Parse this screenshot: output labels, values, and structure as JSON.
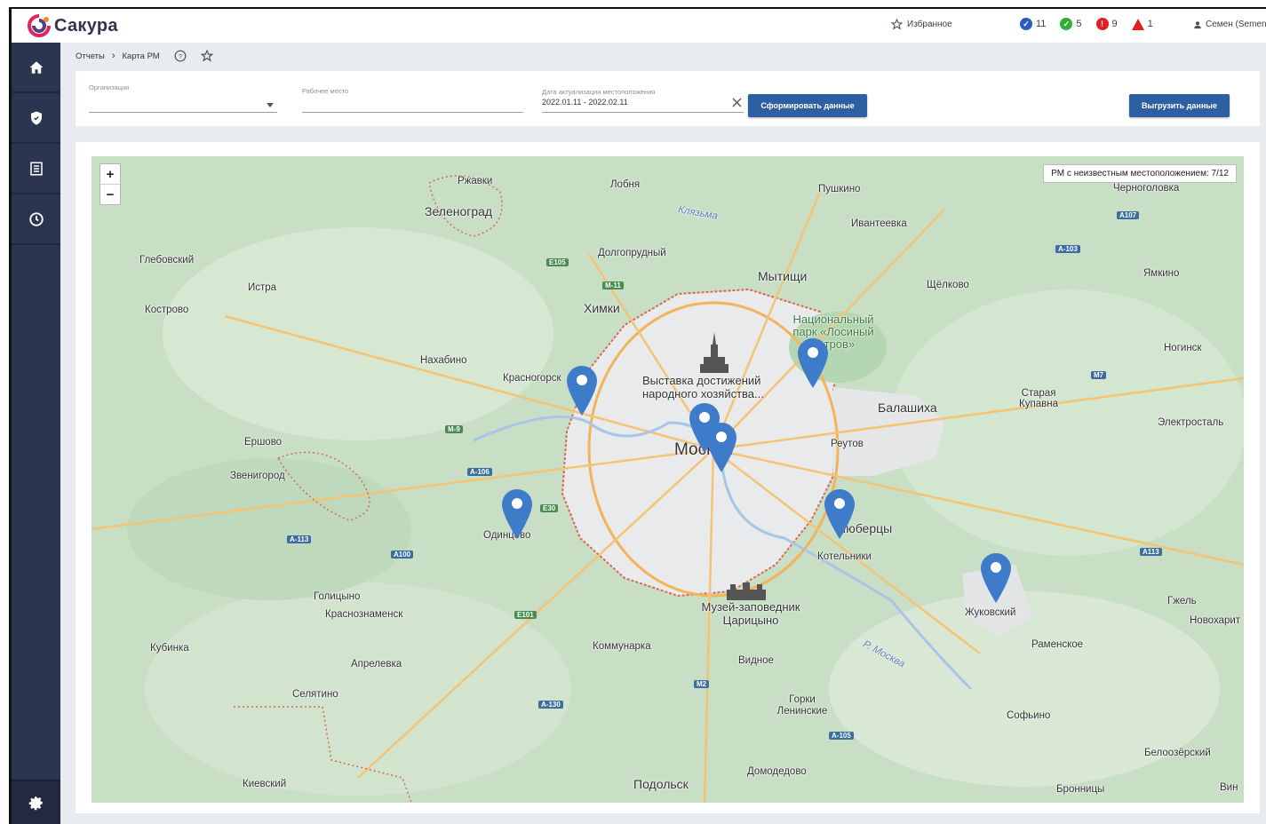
{
  "app": {
    "name": "Сакура"
  },
  "header": {
    "favorites_label": "Избранное",
    "counters": [
      {
        "icon": "check-shield-icon",
        "color": "#2b5eb8",
        "value": "11"
      },
      {
        "icon": "check-circle-icon",
        "color": "#2fae3a",
        "value": "5"
      },
      {
        "icon": "alert-circle-icon",
        "color": "#e02020",
        "value": "9"
      },
      {
        "icon": "warning-triangle-icon",
        "color": "#e02020",
        "value": "1"
      }
    ],
    "user_name": "Семен (Semen)"
  },
  "sidebar": {
    "items": [
      {
        "icon": "home-icon"
      },
      {
        "icon": "shield-icon"
      },
      {
        "icon": "report-icon"
      },
      {
        "icon": "clock-icon"
      }
    ],
    "bottom_icon": "gear-icon"
  },
  "breadcrumb": {
    "items": [
      "Отчеты",
      "Карта РМ"
    ]
  },
  "filters": {
    "organization_label": "Организация",
    "organization_value": "",
    "workplace_label": "Рабочее место",
    "workplace_value": "",
    "date_label": "Дата актуализации местоположения",
    "date_value": "2022.01.11 - 2022.02.11",
    "generate_button": "Сформировать данные",
    "export_button": "Выгрузить данные"
  },
  "map": {
    "zoom_in": "+",
    "zoom_out": "−",
    "unknown_location": "РМ с неизвестным местоположением: 7/12",
    "labels": {
      "rzhavki": "Ржавки",
      "lobnya": "Лобня",
      "pushkino": "Пушкино",
      "zelenograd": "Зеленоград",
      "klyazma": "Клязьма",
      "ivanteevka": "Ивантеевка",
      "chernogolovka": "Черноголовка",
      "dolgoprudny": "Долгопрудный",
      "glebovsky": "Глебовский",
      "istra": "Истра",
      "mytishchi": "Мытищи",
      "shchyolkovo": "Щёлково",
      "yamkino": "Ямкино",
      "kostrovo": "Кострово",
      "khimki": "Химки",
      "national_park": "Национальный парк «Лосиный остров»",
      "nakhabino": "Нахабино",
      "noginsk": "Ногинск",
      "krasnogorsk": "Красногорск",
      "vdnkh": "Выставка достижений народного хозяйства...",
      "balashikha": "Балашиха",
      "staraya_kupavna": "Старая Купавна",
      "ershovo": "Ершово",
      "moscow": "Москва",
      "reutov": "Реутов",
      "elektrostal": "Электросталь",
      "zvenigorod": "Звенигород",
      "odintsovo": "Одинцово",
      "lyubertsy": "Люберцы",
      "kotelniki": "Котельники",
      "golitsyno": "Голицыно",
      "krasnoznamensk": "Краснознаменск",
      "tsaritsyno": "Музей-заповедник Царицыно",
      "zhukovsky": "Жуковский",
      "gzhel": "Гжель",
      "novokharitonovo": "Новохарит",
      "kubinka": "Кубинка",
      "kommunarka": "Коммунарка",
      "ramenskoye": "Раменское",
      "aprelevka": "Апрелевка",
      "vidnoye": "Видное",
      "moskva_river": "Р. Москва",
      "selyatino": "Селятино",
      "gorki": "Горки Ленинские",
      "sofyino": "Софьино",
      "domodedovo": "Домодедово",
      "beloozersky": "Белоозёрский",
      "kievsky": "Киевский",
      "podolsk": "Подольск",
      "bronnitsy": "Бронницы",
      "vin": "Вин"
    },
    "roads": {
      "e105": "E105",
      "m11": "M-11",
      "a107": "A107",
      "a103": "A-103",
      "m7": "M7",
      "m9": "M-9",
      "a106": "A-106",
      "e30": "E30",
      "a113": "A-113",
      "a100": "A100",
      "e101": "E101",
      "a113b": "A113",
      "m2": "M2",
      "a130": "A-130",
      "a105": "A-105"
    }
  },
  "colors": {
    "sidebar": "#2b3550",
    "primary_button": "#2e5fa3",
    "pin": "#3e7cc9"
  }
}
